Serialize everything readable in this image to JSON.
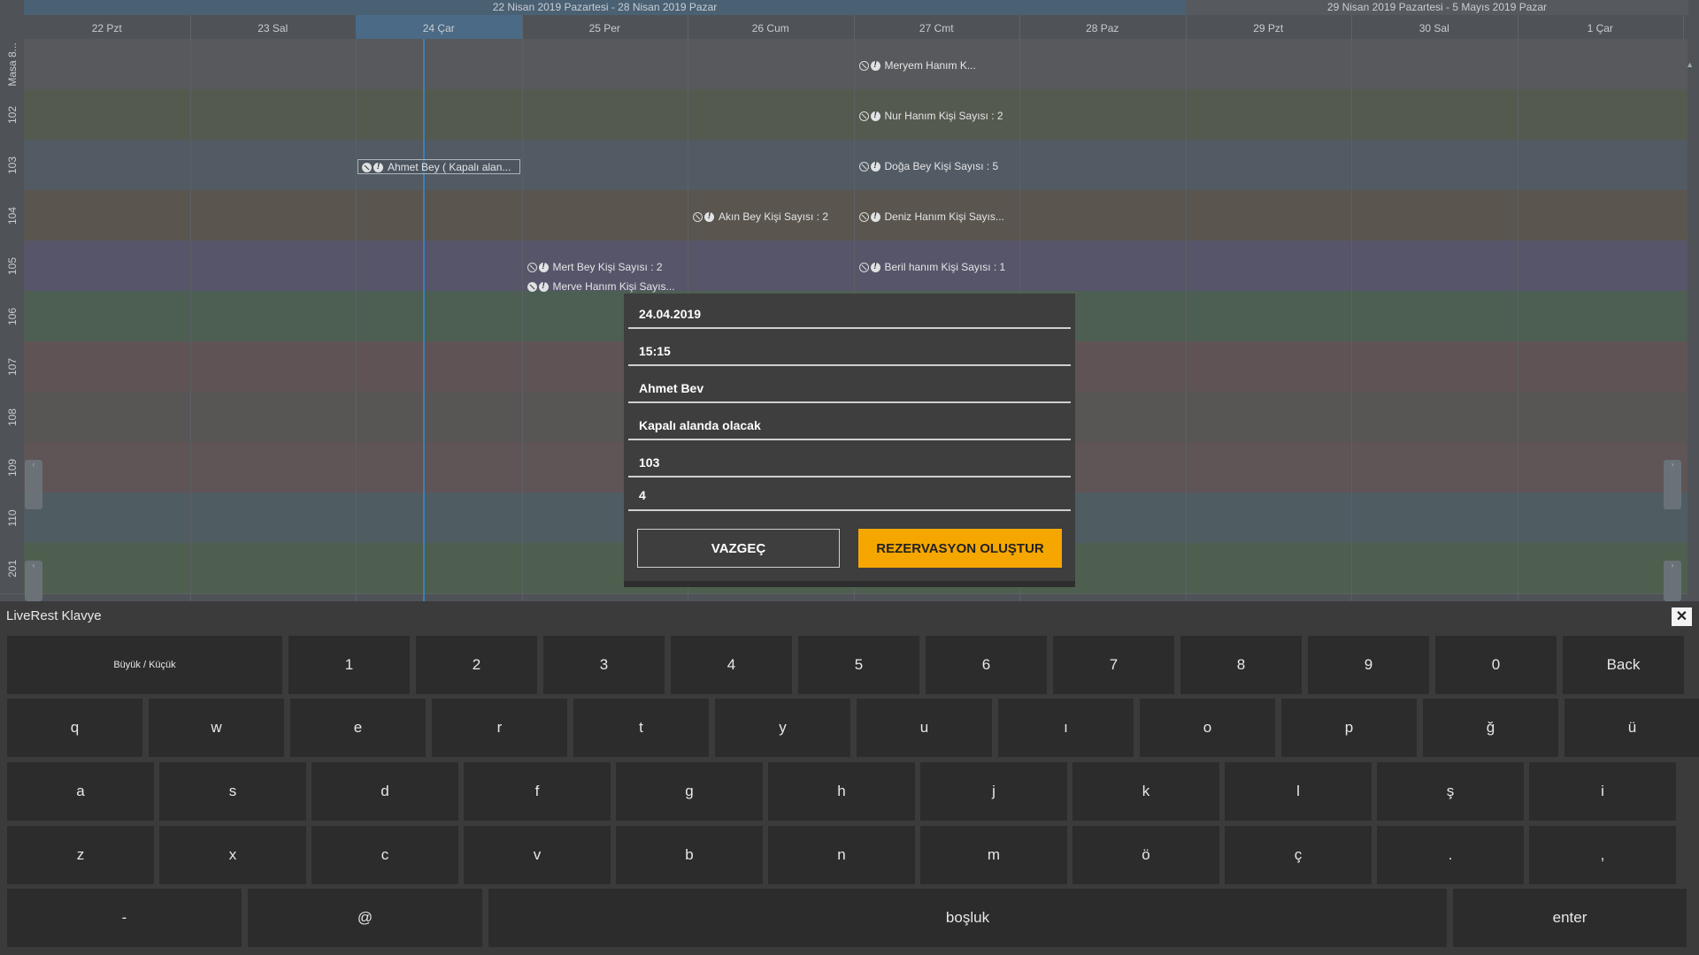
{
  "calendar": {
    "week_bands": [
      "22 Nisan 2019 Pazartesi - 28 Nisan 2019 Pazar",
      "29 Nisan 2019 Pazartesi - 5 Mayıs 2019 Pazar"
    ],
    "days": [
      "22 Pzt",
      "23 Sal",
      "24 Çar",
      "25 Per",
      "26 Cum",
      "27 Cmt",
      "28 Paz",
      "29 Pzt",
      "30 Sal",
      "1 Çar"
    ],
    "today_index": 2,
    "rows": [
      "Masa 8...",
      "102",
      "103",
      "104",
      "105",
      "106",
      "107",
      "108",
      "109",
      "110",
      "201"
    ],
    "row_colors": [
      "#57595c",
      "#555a4f",
      "#525a63",
      "#5a554e",
      "#57556a",
      "#4d5f52",
      "#5f5356",
      "#585654",
      "#5f5456",
      "#4f5d63",
      "#4f5f4f"
    ],
    "events": [
      {
        "text": "Meryem Hanım  K...",
        "day": 5,
        "row": 0,
        "slot": 0
      },
      {
        "text": "Nur Hanım  Kişi Sayısı : 2",
        "day": 5,
        "row": 1,
        "slot": 0
      },
      {
        "text": "Ahmet Bey ( Kapalı alan...",
        "day": 2,
        "row": 2,
        "slot": 0,
        "boxed": true,
        "filled": true
      },
      {
        "text": "Doğa Bey  Kişi Sayısı : 5",
        "day": 5,
        "row": 2,
        "slot": 0
      },
      {
        "text": "Akın Bey  Kişi Sayısı : 2",
        "day": 4,
        "row": 3,
        "slot": 0
      },
      {
        "text": "Deniz Hanım  Kişi Sayıs...",
        "day": 5,
        "row": 3,
        "slot": 0
      },
      {
        "text": "Mert Bey  Kişi Sayısı : 2",
        "day": 3,
        "row": 4,
        "slot": 0
      },
      {
        "text": "Merve Hanım  Kişi Sayıs...",
        "day": 3,
        "row": 4,
        "slot": 1,
        "filled": true
      },
      {
        "text": "Beril hanım  Kişi Sayısı : 1",
        "day": 5,
        "row": 4,
        "slot": 0
      }
    ]
  },
  "dialog": {
    "date": "24.04.2019",
    "time": "15:15",
    "name": "Ahmet Bev",
    "note": "Kapalı alanda olacak",
    "table": "103",
    "people": "4",
    "cancel_label": "VAZGEÇ",
    "create_label": "REZERVASYON OLUŞTUR"
  },
  "keyboard": {
    "title": "LiveRest Klavye",
    "close_label": "✕",
    "rows": [
      [
        "Büyük / Küçük",
        "1",
        "2",
        "3",
        "4",
        "5",
        "6",
        "7",
        "8",
        "9",
        "0",
        "Back"
      ],
      [
        "q",
        "w",
        "e",
        "r",
        "t",
        "y",
        "u",
        "ı",
        "o",
        "p",
        "ğ",
        "ü"
      ],
      [
        "a",
        "s",
        "d",
        "f",
        "g",
        "h",
        "j",
        "k",
        "l",
        "ş",
        "i"
      ],
      [
        "z",
        "x",
        "c",
        "v",
        "b",
        "n",
        "m",
        "ö",
        "ç",
        ".",
        ","
      ],
      [
        "-",
        "@",
        "boşluk",
        "enter"
      ]
    ]
  },
  "colors": {
    "accent": "#f5a700",
    "today": "#4a6a86",
    "now_line": "#3f7fb5"
  }
}
